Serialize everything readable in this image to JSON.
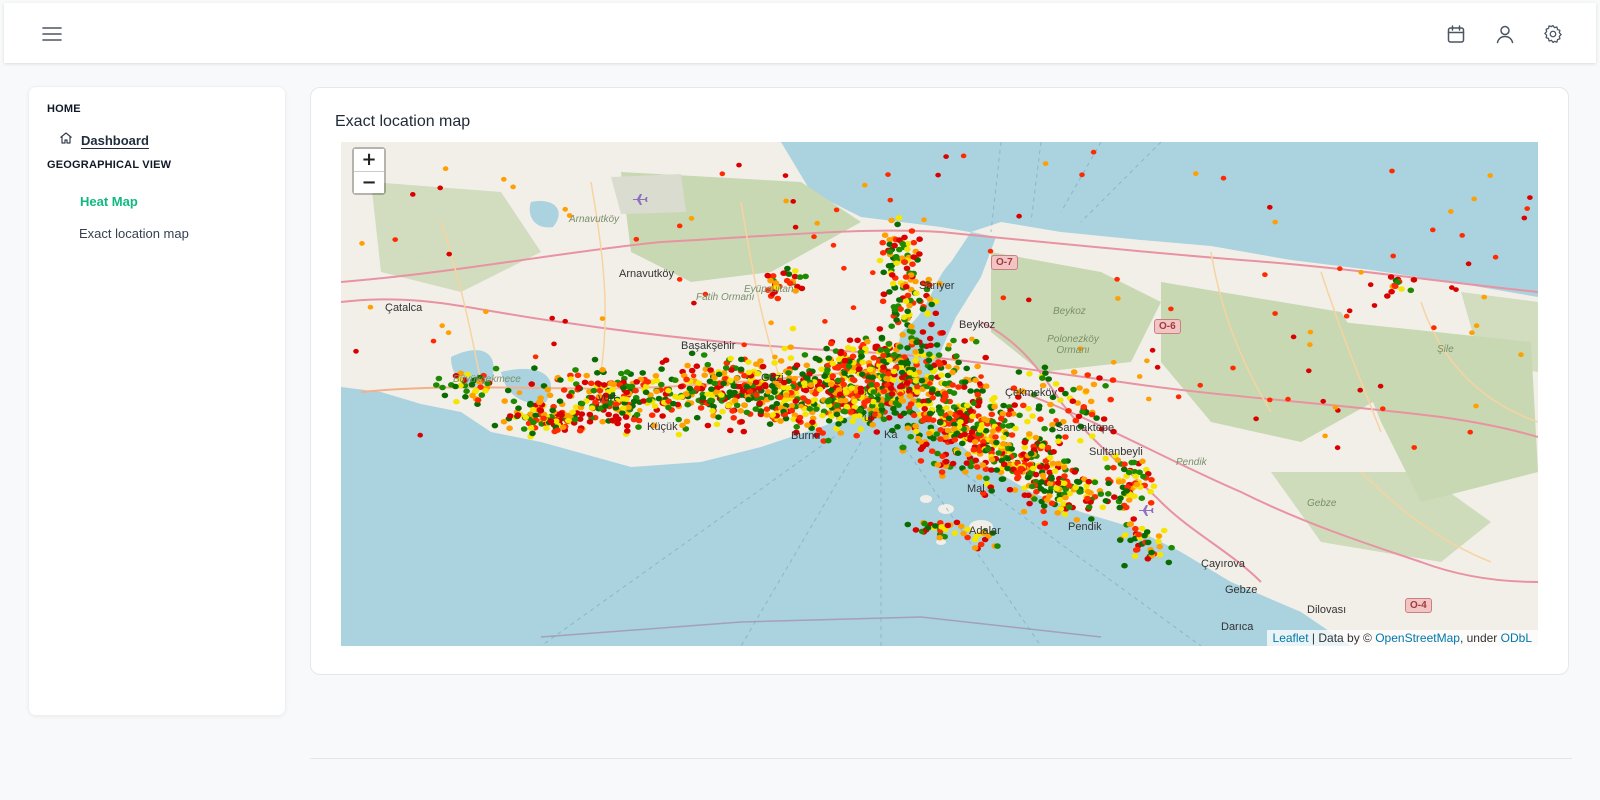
{
  "icons": {
    "menu": "hamburger-menu-icon",
    "calendar": "calendar-icon",
    "user": "user-icon",
    "settings": "gear-icon",
    "home": "home-icon"
  },
  "sidebar": {
    "home_section": "HOME",
    "dashboard": "Dashboard",
    "geo_section": "GEOGRAPHICAL VIEW",
    "heat_map": "Heat Map",
    "exact_location": "Exact location map"
  },
  "card": {
    "title": "Exact location map"
  },
  "map": {
    "zoom_in": "+",
    "zoom_out": "−",
    "labels": {
      "arnavutkoy_top": "Arnavutköy",
      "arnavutkoy": "Arnavutköy",
      "fatih_ormani": "Fatih Ormanı",
      "eyupsultan": "Eyüpsultan",
      "catalca": "Çatalca",
      "basaksehir": "Başakşehir",
      "buyukcekmece": "Büyükçekmece",
      "esenyurt": "yurt",
      "kucuk": "Küçük",
      "gazi": "Gazi",
      "burnu": "Burnu",
      "sariyer": "Sarıyer",
      "beykoz_forest": "Beykoz",
      "beykoz": "Beykoz",
      "polonezkoy": "Polonezköy Ormanı",
      "cekmekoy": "Çekmeköy",
      "sancaktepe": "Sancaktepe",
      "sultanbeyli": "Sultanbeyli",
      "maltepe": "Mal",
      "adalar": "Adalar",
      "pendik_short": "Pendik",
      "pendik_forest": "Pendik",
      "gebze_forest": "Gebze",
      "cayirova": "Çayırova",
      "gebze": "Gebze",
      "darica": "Darıca",
      "dilovasi": "Dilovası",
      "sile": "Şile",
      "istanbul": "ul",
      "kadikoy": "Ka"
    },
    "roads": {
      "o7": "O-7",
      "o6": "O-6",
      "o4": "O-4"
    },
    "attribution": {
      "leaflet": "Leaflet",
      "separator": " | Data by © ",
      "osm": "OpenStreetMap",
      "under": ", under ",
      "odbl": "ODbL"
    },
    "marker_colors": [
      "#d90000",
      "#ff2a00",
      "#ff9f00",
      "#f4e600",
      "#1f8a00",
      "#0a6b00"
    ]
  }
}
